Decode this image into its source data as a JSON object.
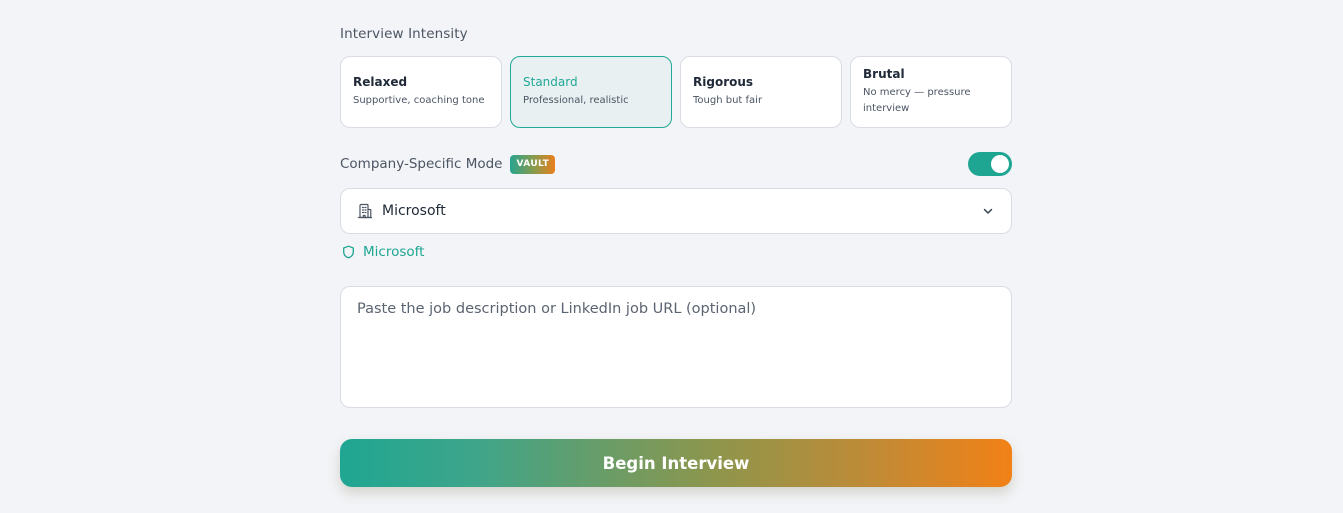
{
  "intensity": {
    "label": "Interview Intensity",
    "options": [
      {
        "title": "Relaxed",
        "subtitle": "Supportive, coaching tone",
        "selected": false
      },
      {
        "title": "Standard",
        "subtitle": "Professional, realistic",
        "selected": true
      },
      {
        "title": "Rigorous",
        "subtitle": "Tough but fair",
        "selected": false
      },
      {
        "title": "Brutal",
        "subtitle": "No mercy — pressure interview",
        "selected": false
      }
    ]
  },
  "company_mode": {
    "label": "Company-Specific Mode",
    "badge": "VAULT",
    "enabled": true
  },
  "company_select": {
    "value": "Microsoft",
    "icon": "building-icon"
  },
  "selected_company": {
    "name": "Microsoft",
    "icon": "shield-icon"
  },
  "job_description": {
    "placeholder": "Paste the job description or LinkedIn job URL (optional)",
    "value": ""
  },
  "begin_button": {
    "label": "Begin Interview"
  },
  "colors": {
    "accent": "#1fa692",
    "accent_end": "#f28116",
    "background": "#f3f4f7"
  }
}
